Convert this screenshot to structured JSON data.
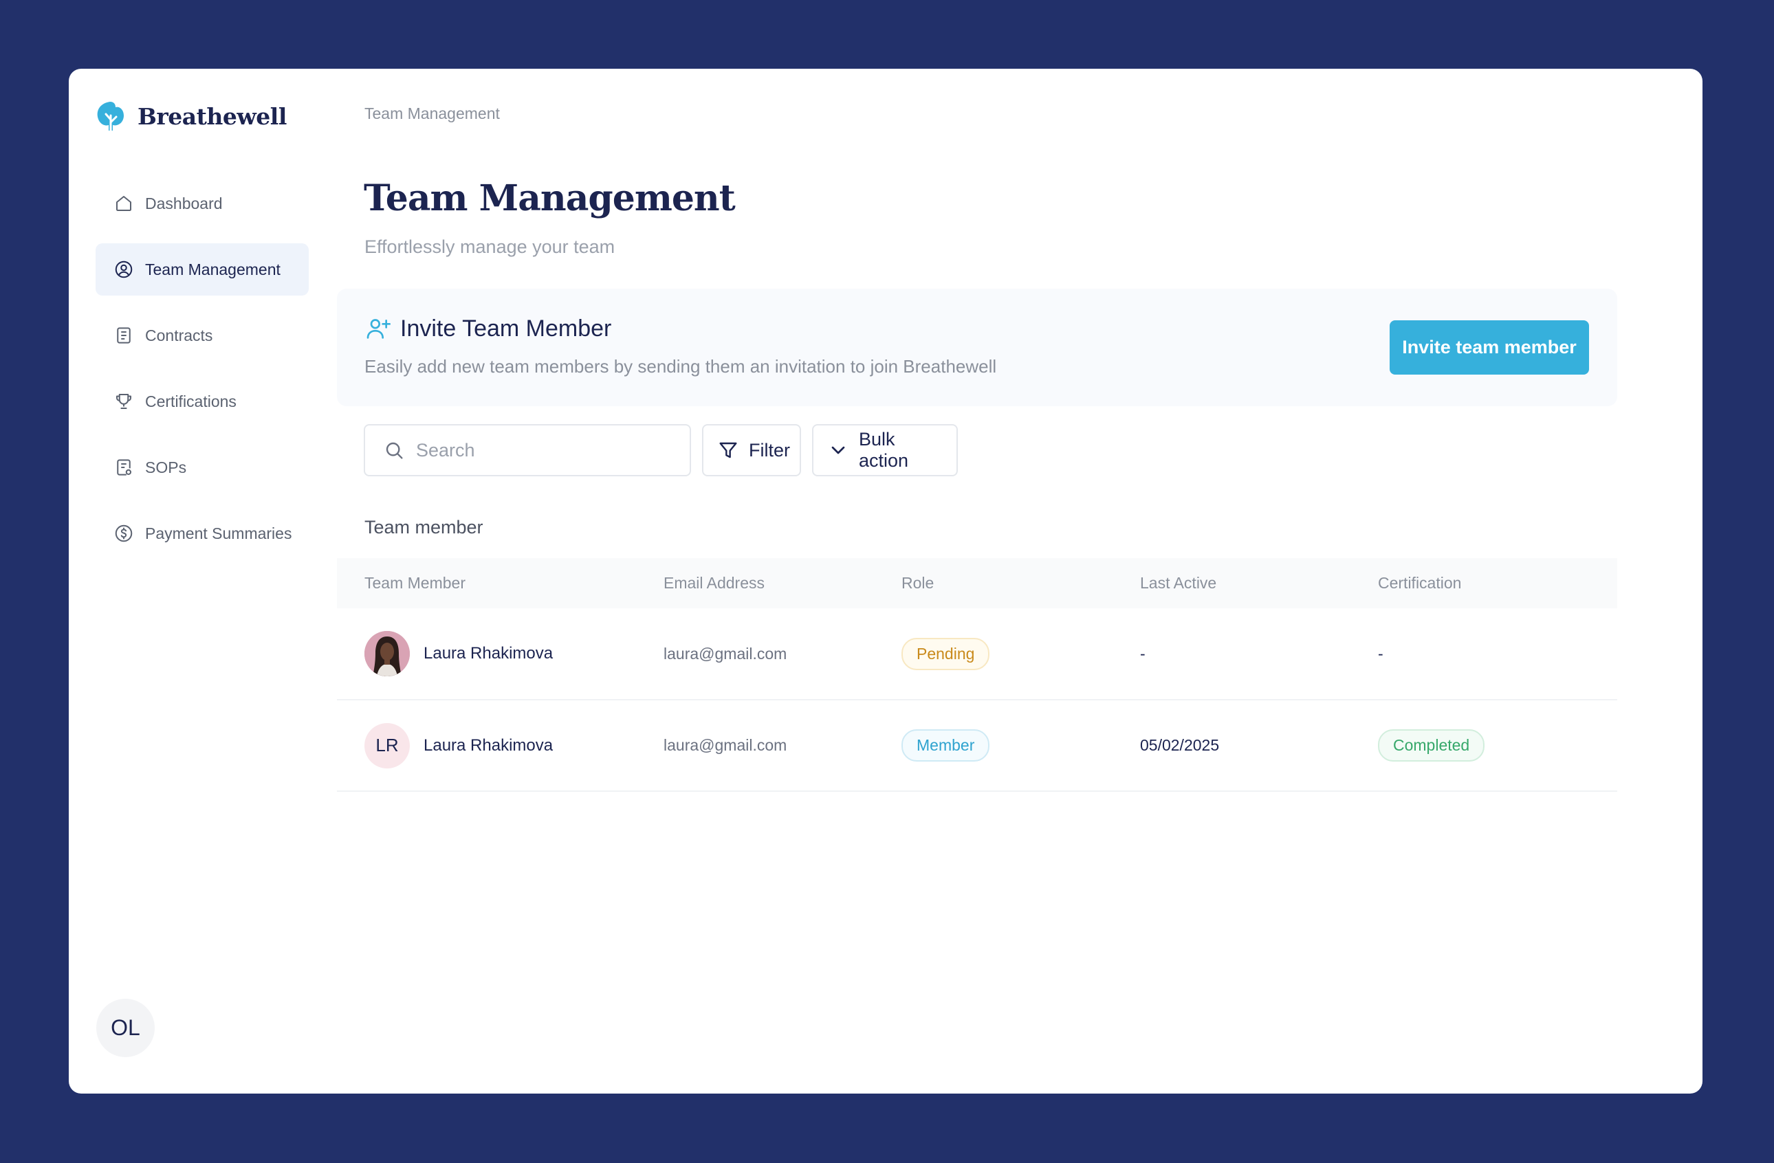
{
  "app": {
    "brand": "Breathewell",
    "user_initials": "OL"
  },
  "sidebar": {
    "items": [
      {
        "label": "Dashboard",
        "icon": "home-icon",
        "active": false
      },
      {
        "label": "Team Management",
        "icon": "user-circle-icon",
        "active": true
      },
      {
        "label": "Contracts",
        "icon": "document-icon",
        "active": false
      },
      {
        "label": "Certifications",
        "icon": "trophy-icon",
        "active": false
      },
      {
        "label": "SOPs",
        "icon": "file-settings-icon",
        "active": false
      },
      {
        "label": "Payment Summaries",
        "icon": "dollar-circle-icon",
        "active": false
      }
    ]
  },
  "header": {
    "breadcrumb": "Team Management",
    "title": "Team Management",
    "subtitle": "Effortlessly manage your team"
  },
  "invite": {
    "title": "Invite Team Member",
    "description": "Easily add new team members by sending them an invitation to join Breathewell",
    "button_label": "Invite team member"
  },
  "toolbar": {
    "search_placeholder": "Search",
    "filter_label": "Filter",
    "bulk_label": "Bulk action"
  },
  "table": {
    "section_label": "Team member",
    "columns": [
      "Team Member",
      "Email Address",
      "Role",
      "Last Active",
      "Certification"
    ],
    "rows": [
      {
        "name": "Laura Rhakimova",
        "avatar": "photo",
        "initials": "",
        "email": "laura@gmail.com",
        "role": "Pending",
        "last_active": "-",
        "certification": "-"
      },
      {
        "name": "Laura Rhakimova",
        "avatar": "initials",
        "initials": "LR",
        "email": "laura@gmail.com",
        "role": "Member",
        "last_active": "05/02/2025",
        "certification": "Completed"
      }
    ]
  },
  "colors": {
    "page_background": "#22306a",
    "primary_button": "#36b0dc",
    "pending": "#c98a1b",
    "member": "#2fa3cf",
    "completed": "#36a86a"
  }
}
